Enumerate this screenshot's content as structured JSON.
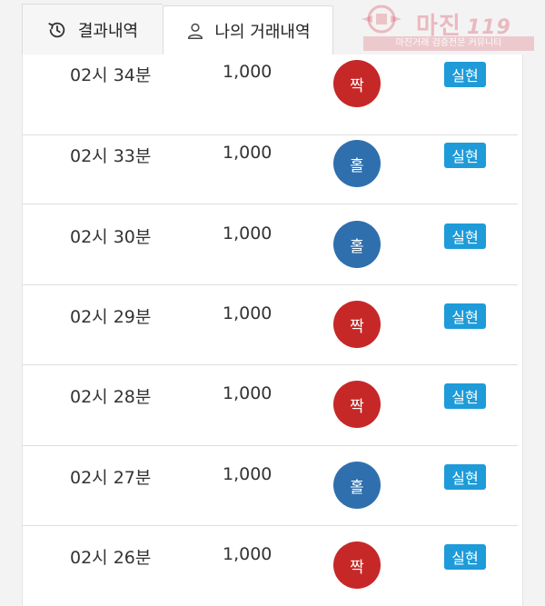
{
  "tabs": [
    {
      "label": "결과내역",
      "icon": "history-icon",
      "active": false
    },
    {
      "label": "나의 거래내역",
      "icon": "user-icon",
      "active": true
    }
  ],
  "watermark": {
    "title": "마진",
    "suffix": "119",
    "subtitle": "마진거래 검증전문 커뮤니티"
  },
  "colors": {
    "even": "#c62828",
    "odd": "#2f6fae",
    "badge": "#1e9bd8"
  },
  "rows": [
    {
      "time": "02시 34분",
      "amount": "1,000",
      "result": "짝",
      "result_type": "even",
      "status": "실현"
    },
    {
      "time": "02시 33분",
      "amount": "1,000",
      "result": "홀",
      "result_type": "odd",
      "status": "실현"
    },
    {
      "time": "02시 30분",
      "amount": "1,000",
      "result": "홀",
      "result_type": "odd",
      "status": "실현"
    },
    {
      "time": "02시 29분",
      "amount": "1,000",
      "result": "짝",
      "result_type": "even",
      "status": "실현"
    },
    {
      "time": "02시 28분",
      "amount": "1,000",
      "result": "짝",
      "result_type": "even",
      "status": "실현"
    },
    {
      "time": "02시 27분",
      "amount": "1,000",
      "result": "홀",
      "result_type": "odd",
      "status": "실현"
    },
    {
      "time": "02시 26분",
      "amount": "1,000",
      "result": "짝",
      "result_type": "even",
      "status": "실현"
    }
  ]
}
